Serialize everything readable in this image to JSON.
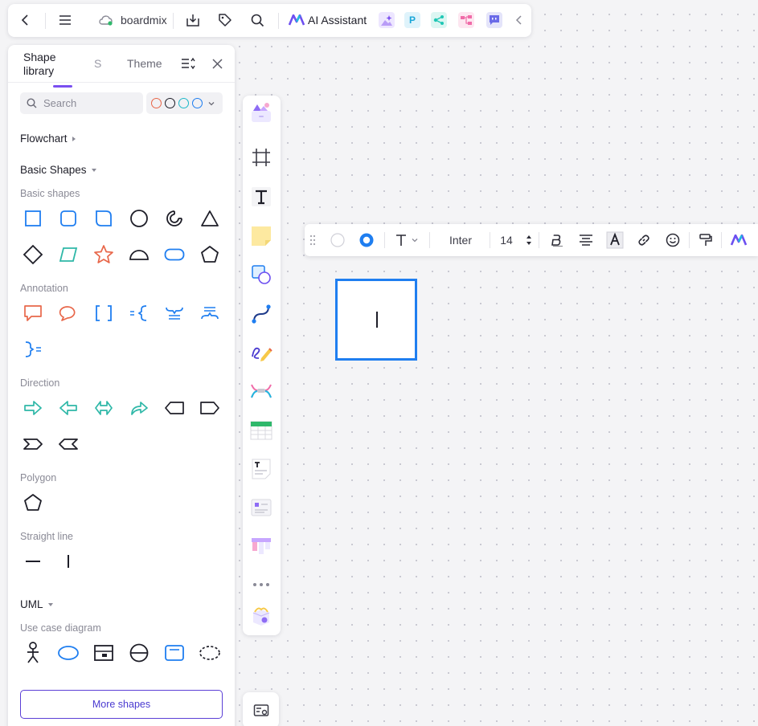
{
  "topbar": {
    "brand": "boardmix",
    "ai_assistant": "AI Assistant",
    "apps": [
      {
        "icon": "ai-image-icon",
        "color": "#a78bfa",
        "glyph": ""
      },
      {
        "icon": "presentation-app-icon",
        "color": "#19b6e8",
        "glyph": "P"
      },
      {
        "icon": "mindmap-app-icon",
        "color": "#1fc7b5",
        "glyph": ""
      },
      {
        "icon": "flowchart-app-icon",
        "color": "#f06ba8",
        "glyph": ""
      },
      {
        "icon": "chat-app-icon",
        "color": "#6a6ae8",
        "glyph": ""
      }
    ]
  },
  "panel": {
    "tabs": {
      "shape_library": "Shape library",
      "s": "S",
      "theme": "Theme"
    },
    "search": {
      "placeholder": "Search"
    },
    "color_filter": [
      "#e8674a",
      "#1e1e28",
      "#1fb8c9",
      "#1f7ef0"
    ],
    "sections": {
      "flowchart": "Flowchart",
      "basic_shapes": "Basic Shapes",
      "uml": "UML"
    },
    "subsections": {
      "basic_shapes": "Basic shapes",
      "annotation": "Annotation",
      "direction": "Direction",
      "polygon": "Polygon",
      "straight_line": "Straight line",
      "use_case": "Use case diagram"
    },
    "more_shapes": "More shapes"
  },
  "format_toolbar": {
    "font_name": "Inter",
    "font_size": "14"
  },
  "colors": {
    "accent": "#1f7ef0",
    "brand_purple": "#5b3fd6",
    "annotation_orange": "#e8674a",
    "direction_teal": "#2fb8a8"
  }
}
